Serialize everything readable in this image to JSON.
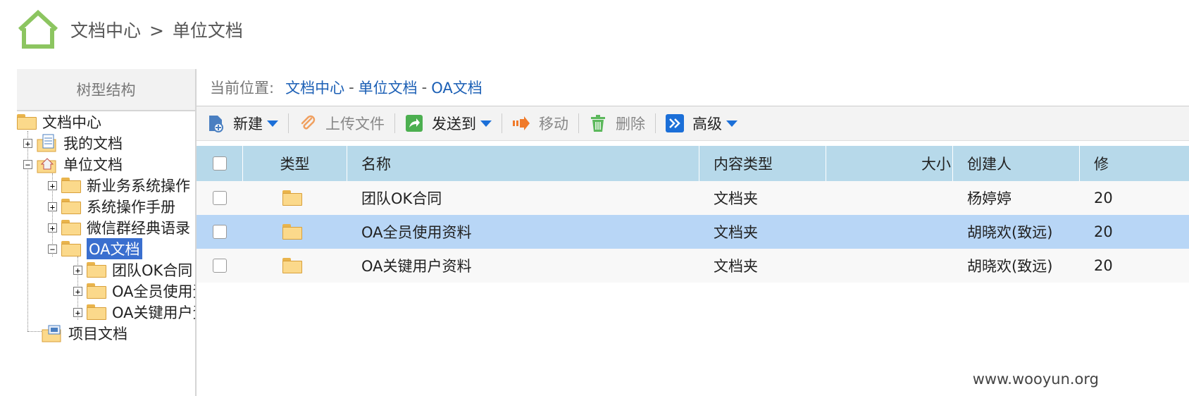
{
  "breadcrumb": {
    "part1": "文档中心",
    "separator": ">",
    "part2": "单位文档"
  },
  "tree": {
    "header": "树型结构",
    "nodes": [
      {
        "label": "文档中心",
        "expander": "",
        "icon": "folder-icon"
      },
      {
        "label": "我的文档",
        "expander": "+",
        "icon": "document-folder-icon"
      },
      {
        "label": "单位文档",
        "expander": "−",
        "icon": "home-folder-icon"
      },
      {
        "label": "新业务系统操作",
        "expander": "+",
        "icon": "folder-icon"
      },
      {
        "label": "系统操作手册",
        "expander": "+",
        "icon": "folder-icon"
      },
      {
        "label": "微信群经典语录",
        "expander": "+",
        "icon": "folder-icon"
      },
      {
        "label": "OA文档",
        "expander": "−",
        "icon": "folder-icon",
        "selected": true
      },
      {
        "label": "团队OK合同",
        "expander": "+",
        "icon": "folder-icon"
      },
      {
        "label": "OA全员使用资料",
        "expander": "+",
        "icon": "folder-icon"
      },
      {
        "label": "OA关键用户资料",
        "expander": "+",
        "icon": "folder-icon"
      },
      {
        "label": "项目文档",
        "expander": "",
        "icon": "project-folder-icon"
      }
    ]
  },
  "location": {
    "label": "当前位置:",
    "path": [
      "文档中心",
      "单位文档",
      "OA文档"
    ],
    "separator": "-"
  },
  "toolbar": {
    "new_label": "新建",
    "upload_label": "上传文件",
    "send_label": "发送到",
    "move_label": "移动",
    "delete_label": "删除",
    "advanced_label": "高级"
  },
  "grid": {
    "columns": {
      "type": "类型",
      "name": "名称",
      "content_type": "内容类型",
      "size": "大小",
      "creator": "创建人",
      "modified": "修"
    },
    "rows": [
      {
        "name": "团队OK合同",
        "content_type": "文档夹",
        "size": "",
        "creator": "杨婷婷",
        "modified": "20",
        "selected": false
      },
      {
        "name": "OA全员使用资料",
        "content_type": "文档夹",
        "size": "",
        "creator": "胡晓欢(致远)",
        "modified": "20",
        "selected": true
      },
      {
        "name": "OA关键用户资料",
        "content_type": "文档夹",
        "size": "",
        "creator": "胡晓欢(致远)",
        "modified": "20",
        "selected": false
      }
    ]
  },
  "watermark": "www.wooyun.org",
  "colors": {
    "accent": "#1b5fb5",
    "selected_row": "#b8d6f6",
    "header_row": "#b7d9ea",
    "home_icon": "#8cc560"
  }
}
